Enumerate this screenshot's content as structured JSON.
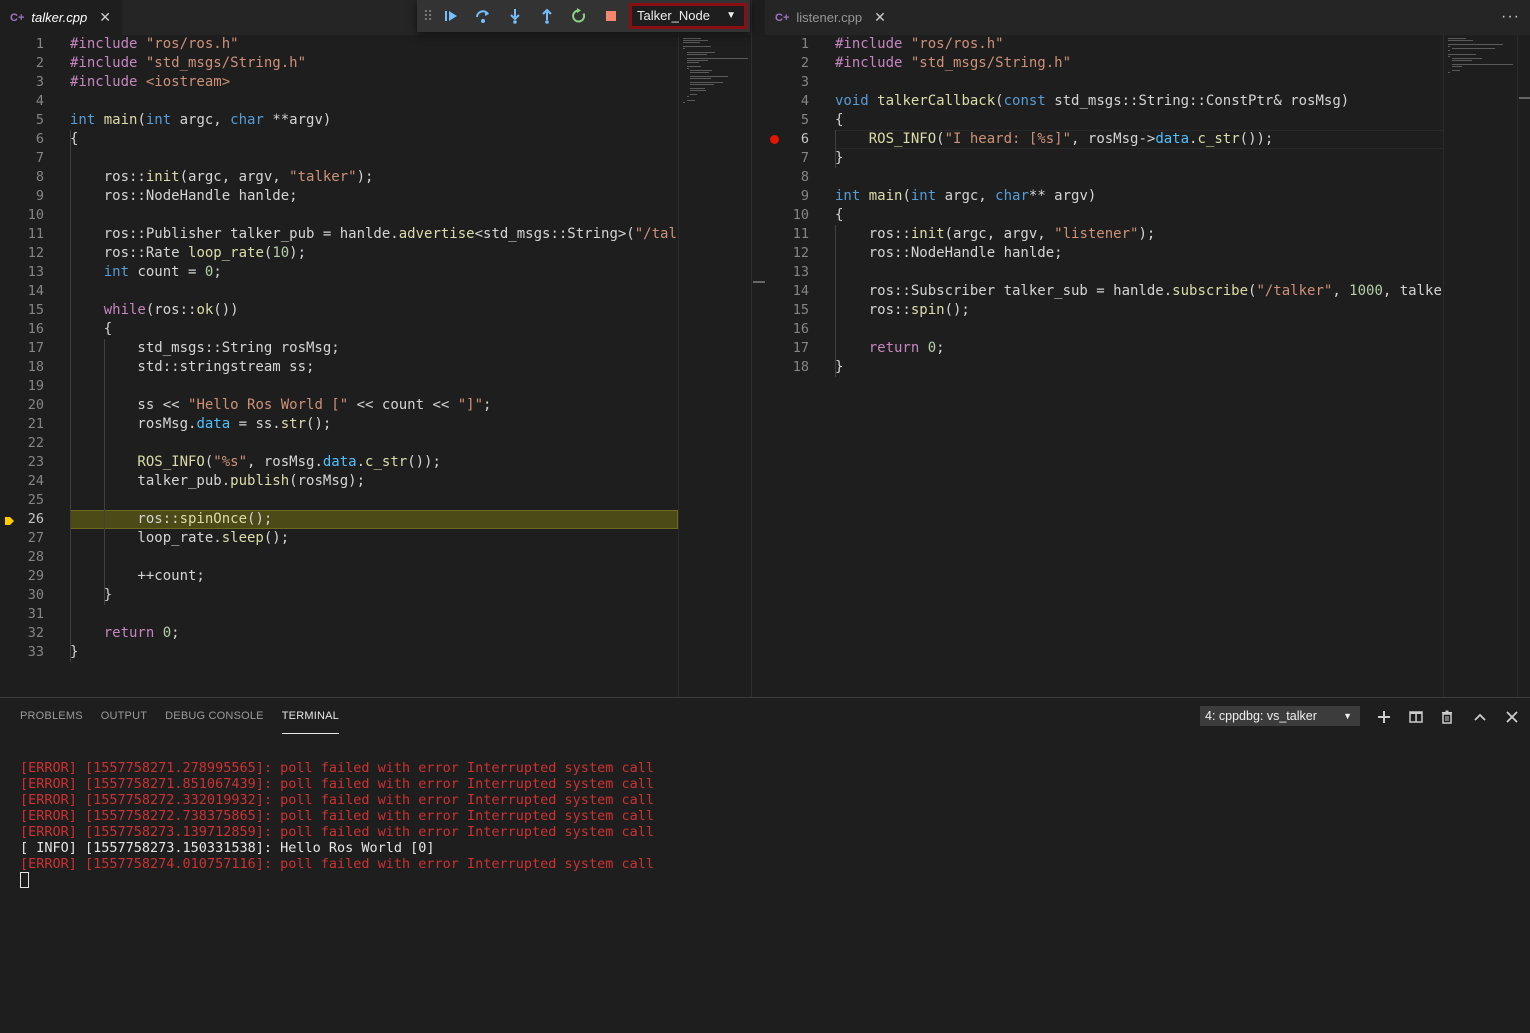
{
  "colors": {
    "error": "#cd3131",
    "breakpoint": "#e51400",
    "highlight": "#4b4b18",
    "config_border": "#8b0f12"
  },
  "debug_toolbar": {
    "icons": [
      "grip-icon",
      "continue-icon",
      "step-over-icon",
      "step-into-icon",
      "step-out-icon",
      "restart-icon",
      "stop-icon"
    ],
    "config": "Talker_Node"
  },
  "left_editor": {
    "tab": "talker.cpp",
    "current_line": "26",
    "lines": [
      {
        "n": "1",
        "t": [
          [
            "p",
            "#include "
          ],
          [
            "s",
            "\"ros/ros.h\""
          ]
        ]
      },
      {
        "n": "2",
        "t": [
          [
            "p",
            "#include "
          ],
          [
            "s",
            "\"std_msgs/String.h\""
          ]
        ]
      },
      {
        "n": "3",
        "t": [
          [
            "p",
            "#include "
          ],
          [
            "s",
            "<iostream>"
          ]
        ]
      },
      {
        "n": "4",
        "t": []
      },
      {
        "n": "5",
        "t": [
          [
            "k",
            "int "
          ],
          [
            "f",
            "main"
          ],
          [
            "d",
            "("
          ],
          [
            "k",
            "int "
          ],
          [
            "d",
            "argc, "
          ],
          [
            "k",
            "char "
          ],
          [
            "d",
            "**argv)"
          ]
        ]
      },
      {
        "n": "6",
        "t": [
          [
            "d",
            "{"
          ]
        ]
      },
      {
        "n": "7",
        "t": []
      },
      {
        "n": "8",
        "t": [
          [
            "d",
            "    ros::"
          ],
          [
            "f",
            "init"
          ],
          [
            "d",
            "(argc, argv, "
          ],
          [
            "s",
            "\"talker\""
          ],
          [
            "d",
            ");"
          ]
        ]
      },
      {
        "n": "9",
        "t": [
          [
            "d",
            "    ros::NodeHandle hanlde;"
          ]
        ]
      },
      {
        "n": "10",
        "t": []
      },
      {
        "n": "11",
        "t": [
          [
            "d",
            "    ros::Publisher talker_pub = hanlde."
          ],
          [
            "f",
            "advertise"
          ],
          [
            "d",
            "<std_msgs::String>("
          ],
          [
            "s",
            "\"/tal"
          ]
        ]
      },
      {
        "n": "12",
        "t": [
          [
            "d",
            "    ros::Rate "
          ],
          [
            "f",
            "loop_rate"
          ],
          [
            "d",
            "("
          ],
          [
            "n",
            "10"
          ],
          [
            "d",
            ");"
          ]
        ]
      },
      {
        "n": "13",
        "t": [
          [
            "k",
            "    int "
          ],
          [
            "d",
            "count = "
          ],
          [
            "n",
            "0"
          ],
          [
            "d",
            ";"
          ]
        ]
      },
      {
        "n": "14",
        "t": []
      },
      {
        "n": "15",
        "t": [
          [
            "p",
            "    while"
          ],
          [
            "d",
            "(ros::"
          ],
          [
            "f",
            "ok"
          ],
          [
            "d",
            "())"
          ]
        ]
      },
      {
        "n": "16",
        "t": [
          [
            "d",
            "    {"
          ]
        ]
      },
      {
        "n": "17",
        "t": [
          [
            "d",
            "        std_msgs::String rosMsg;"
          ]
        ]
      },
      {
        "n": "18",
        "t": [
          [
            "d",
            "        std::stringstream ss;"
          ]
        ]
      },
      {
        "n": "19",
        "t": []
      },
      {
        "n": "20",
        "t": [
          [
            "d",
            "        ss << "
          ],
          [
            "s",
            "\"Hello Ros World [\""
          ],
          [
            "d",
            " << count << "
          ],
          [
            "s",
            "\"]\""
          ],
          [
            "d",
            ";"
          ]
        ]
      },
      {
        "n": "21",
        "t": [
          [
            "d",
            "        rosMsg."
          ],
          [
            "m",
            "data"
          ],
          [
            "d",
            " = ss."
          ],
          [
            "f",
            "str"
          ],
          [
            "d",
            "();"
          ]
        ]
      },
      {
        "n": "22",
        "t": []
      },
      {
        "n": "23",
        "t": [
          [
            "f",
            "        ROS_INFO"
          ],
          [
            "d",
            "("
          ],
          [
            "s",
            "\"%s\""
          ],
          [
            "d",
            ", rosMsg."
          ],
          [
            "m",
            "data"
          ],
          [
            "d",
            "."
          ],
          [
            "f",
            "c_str"
          ],
          [
            "d",
            "());"
          ]
        ]
      },
      {
        "n": "24",
        "t": [
          [
            "d",
            "        talker_pub."
          ],
          [
            "f",
            "publish"
          ],
          [
            "d",
            "(rosMsg);"
          ]
        ]
      },
      {
        "n": "25",
        "t": []
      },
      {
        "n": "26",
        "t": [
          [
            "d",
            "        ros::"
          ],
          [
            "f",
            "spinOnce"
          ],
          [
            "d",
            "();"
          ]
        ]
      },
      {
        "n": "27",
        "t": [
          [
            "d",
            "        loop_rate."
          ],
          [
            "f",
            "sleep"
          ],
          [
            "d",
            "();"
          ]
        ]
      },
      {
        "n": "28",
        "t": []
      },
      {
        "n": "29",
        "t": [
          [
            "d",
            "        ++count;"
          ]
        ]
      },
      {
        "n": "30",
        "t": [
          [
            "d",
            "    }"
          ]
        ]
      },
      {
        "n": "31",
        "t": []
      },
      {
        "n": "32",
        "t": [
          [
            "p",
            "    return "
          ],
          [
            "n",
            "0"
          ],
          [
            "d",
            ";"
          ]
        ]
      },
      {
        "n": "33",
        "t": [
          [
            "d",
            "}"
          ]
        ]
      }
    ]
  },
  "right_editor": {
    "tab": "listener.cpp",
    "current_line": "6",
    "lines": [
      {
        "n": "1",
        "t": [
          [
            "p",
            "#include "
          ],
          [
            "s",
            "\"ros/ros.h\""
          ]
        ]
      },
      {
        "n": "2",
        "t": [
          [
            "p",
            "#include "
          ],
          [
            "s",
            "\"std_msgs/String.h\""
          ]
        ]
      },
      {
        "n": "3",
        "t": []
      },
      {
        "n": "4",
        "t": [
          [
            "k",
            "void "
          ],
          [
            "f",
            "talkerCallback"
          ],
          [
            "d",
            "("
          ],
          [
            "k",
            "const "
          ],
          [
            "d",
            "std_msgs::String::ConstPtr& rosMsg)"
          ]
        ]
      },
      {
        "n": "5",
        "t": [
          [
            "d",
            "{"
          ]
        ]
      },
      {
        "n": "6",
        "t": [
          [
            "f",
            "    ROS_INFO"
          ],
          [
            "d",
            "("
          ],
          [
            "s",
            "\"I heard: [%s]\""
          ],
          [
            "d",
            ", rosMsg->"
          ],
          [
            "m",
            "data"
          ],
          [
            "d",
            "."
          ],
          [
            "f",
            "c_str"
          ],
          [
            "d",
            "());"
          ]
        ]
      },
      {
        "n": "7",
        "t": [
          [
            "d",
            "}"
          ]
        ]
      },
      {
        "n": "8",
        "t": []
      },
      {
        "n": "9",
        "t": [
          [
            "k",
            "int "
          ],
          [
            "f",
            "main"
          ],
          [
            "d",
            "("
          ],
          [
            "k",
            "int "
          ],
          [
            "d",
            "argc, "
          ],
          [
            "k",
            "char"
          ],
          [
            "d",
            "** argv)"
          ]
        ]
      },
      {
        "n": "10",
        "t": [
          [
            "d",
            "{"
          ]
        ]
      },
      {
        "n": "11",
        "t": [
          [
            "d",
            "    ros::"
          ],
          [
            "f",
            "init"
          ],
          [
            "d",
            "(argc, argv, "
          ],
          [
            "s",
            "\"listener\""
          ],
          [
            "d",
            ");"
          ]
        ]
      },
      {
        "n": "12",
        "t": [
          [
            "d",
            "    ros::NodeHandle hanlde;"
          ]
        ]
      },
      {
        "n": "13",
        "t": []
      },
      {
        "n": "14",
        "t": [
          [
            "d",
            "    ros::Subscriber talker_sub = hanlde."
          ],
          [
            "f",
            "subscribe"
          ],
          [
            "d",
            "("
          ],
          [
            "s",
            "\"/talker\""
          ],
          [
            "d",
            ", "
          ],
          [
            "n",
            "1000"
          ],
          [
            "d",
            ", talke"
          ]
        ]
      },
      {
        "n": "15",
        "t": [
          [
            "d",
            "    ros::"
          ],
          [
            "f",
            "spin"
          ],
          [
            "d",
            "();"
          ]
        ]
      },
      {
        "n": "16",
        "t": []
      },
      {
        "n": "17",
        "t": [
          [
            "p",
            "    return "
          ],
          [
            "n",
            "0"
          ],
          [
            "d",
            ";"
          ]
        ]
      },
      {
        "n": "18",
        "t": [
          [
            "d",
            "}"
          ]
        ]
      }
    ]
  },
  "panel": {
    "tabs": [
      "PROBLEMS",
      "OUTPUT",
      "DEBUG CONSOLE",
      "TERMINAL"
    ],
    "active_tab": "TERMINAL",
    "terminal_select": "4: cppdbg: vs_talker",
    "icons": [
      "plus-icon",
      "split-icon",
      "trash-icon",
      "chevron-up-icon",
      "close-icon"
    ],
    "terminal_lines": [
      {
        "type": "error",
        "text": "[ERROR] [1557758271.278995565]: poll failed with error Interrupted system call"
      },
      {
        "type": "error",
        "text": "[ERROR] [1557758271.851067439]: poll failed with error Interrupted system call"
      },
      {
        "type": "error",
        "text": "[ERROR] [1557758272.332019932]: poll failed with error Interrupted system call"
      },
      {
        "type": "error",
        "text": "[ERROR] [1557758272.738375865]: poll failed with error Interrupted system call"
      },
      {
        "type": "error",
        "text": "[ERROR] [1557758273.139712859]: poll failed with error Interrupted system call"
      },
      {
        "type": "info",
        "text": "[ INFO] [1557758273.150331538]: Hello Ros World [0]"
      },
      {
        "type": "error",
        "text": "[ERROR] [1557758274.010757116]: poll failed with error Interrupted system call"
      }
    ]
  }
}
